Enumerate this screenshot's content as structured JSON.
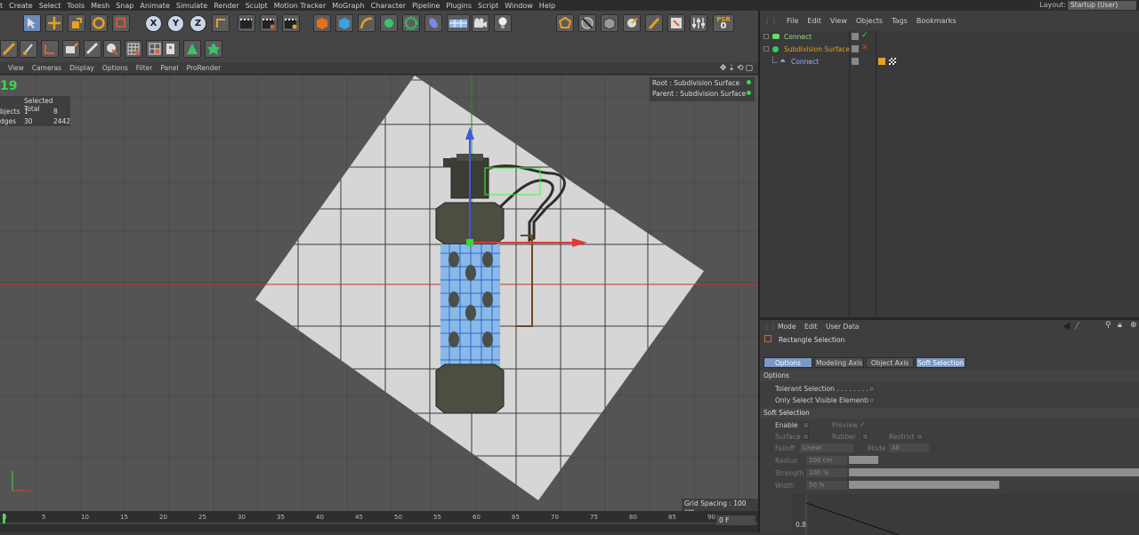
{
  "menubar": {
    "items": [
      "Create",
      "Select",
      "Tools",
      "Mesh",
      "Snap",
      "Animate",
      "Simulate",
      "Render",
      "Sculpt",
      "Motion Tracker",
      "MoGraph",
      "Character",
      "Pipeline",
      "Plugins",
      "Script",
      "Window",
      "Help"
    ],
    "layout_label": "Layout:",
    "layout_value": "Startup (User)"
  },
  "toolbar": {
    "axis_x": "X",
    "axis_y": "Y",
    "axis_z": "Z",
    "psr_label": "PSR",
    "psr_value": "0"
  },
  "viewport": {
    "menu": [
      "View",
      "Cameras",
      "Display",
      "Options",
      "Filter",
      "Panel",
      "ProRender"
    ],
    "stats_header": "Selected Total",
    "stats_rows": [
      {
        "label": "bjects",
        "selected": "1",
        "total": "8"
      },
      {
        "label": "dges",
        "selected": "30",
        "total": "2442"
      }
    ],
    "root_label": "Root : Subdivision Surface",
    "parent_label": "Parent : Subdivision Surface",
    "grid_spacing": "Grid Spacing : 100 cm"
  },
  "timeline": {
    "ticks": [
      "0",
      "5",
      "10",
      "15",
      "20",
      "25",
      "30",
      "35",
      "40",
      "45",
      "50",
      "55",
      "60",
      "65",
      "70",
      "75",
      "80",
      "85",
      "90"
    ],
    "frame_field": "0 F"
  },
  "object_manager": {
    "menu": [
      "File",
      "Edit",
      "View",
      "Objects",
      "Tags",
      "Bookmarks"
    ],
    "objects": [
      {
        "name": "Connect",
        "color": "#9fdc8c"
      },
      {
        "name": "Subdivision Surface",
        "color": "#e0a020"
      },
      {
        "name": "Connect",
        "color": "#8fb4ff"
      }
    ]
  },
  "attribute_manager": {
    "menu": [
      "Mode",
      "Edit",
      "User Data"
    ],
    "tool_name": "Rectangle Selection",
    "tabs": [
      "Options",
      "Modeling Axis",
      "Object Axis",
      "Soft Selection"
    ],
    "options_section": "Options",
    "tolerant": "Tolerant Selection . . . . . . . .",
    "only_visible": "Only Select Visible Elements",
    "soft_section": "Soft Selection",
    "enable": "Enable",
    "preview": "Preview",
    "surface": "Surface",
    "rubber": "Rubber",
    "restrict": "Restrict",
    "falloff": "Falloff",
    "falloff_value": "Linear",
    "mode": "Mode",
    "mode_value": "All",
    "radius": "Radius",
    "radius_value": "100 cm",
    "strength": "Strength",
    "strength_value": "100 %",
    "width": "Width",
    "width_value": "50 %",
    "graph_value": "0.8"
  }
}
